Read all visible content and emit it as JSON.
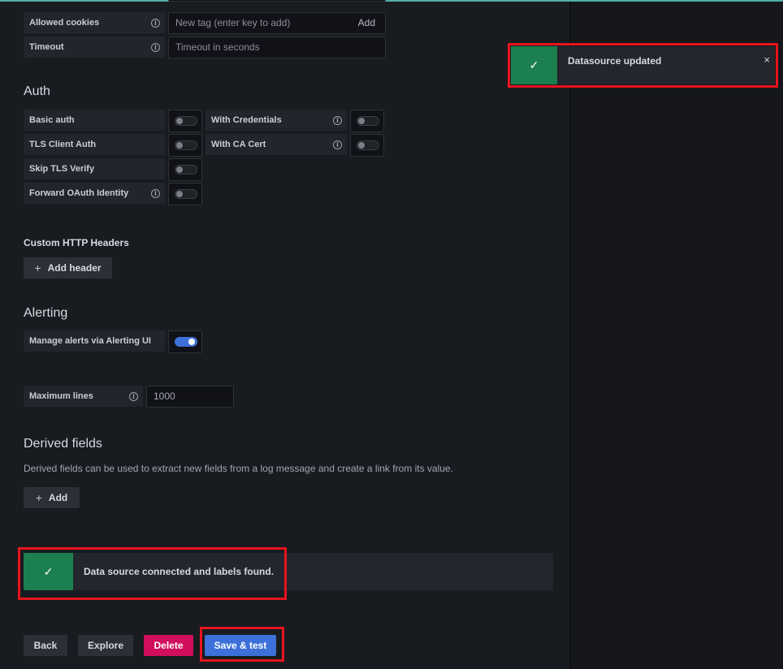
{
  "http": {
    "allowed_cookies_label": "Allowed cookies",
    "allowed_cookies_placeholder": "New tag (enter key to add)",
    "allowed_cookies_add": "Add",
    "timeout_label": "Timeout",
    "timeout_placeholder": "Timeout in seconds"
  },
  "auth": {
    "title": "Auth",
    "basic_auth": "Basic auth",
    "with_credentials": "With Credentials",
    "tls_client_auth": "TLS Client Auth",
    "with_ca_cert": "With CA Cert",
    "skip_tls_verify": "Skip TLS Verify",
    "forward_oauth": "Forward OAuth Identity"
  },
  "headers": {
    "title": "Custom HTTP Headers",
    "add_header": "Add header"
  },
  "alerting": {
    "title": "Alerting",
    "manage_alerts": "Manage alerts via Alerting UI",
    "manage_alerts_on": true
  },
  "max_lines": {
    "label": "Maximum lines",
    "value": "1000"
  },
  "derived": {
    "title": "Derived fields",
    "description": "Derived fields can be used to extract new fields from a log message and create a link from its value.",
    "add": "Add"
  },
  "test_result": {
    "message": "Data source connected and labels found.",
    "status_icon": "check-icon"
  },
  "footer": {
    "back": "Back",
    "explore": "Explore",
    "delete": "Delete",
    "save_test": "Save & test"
  },
  "toast": {
    "message": "Datasource updated",
    "close": "×",
    "status_icon": "check-icon"
  },
  "colors": {
    "success": "#1c7f4f",
    "primary": "#3d71d9",
    "danger": "#d10e5c",
    "highlight": "#e8141e"
  }
}
